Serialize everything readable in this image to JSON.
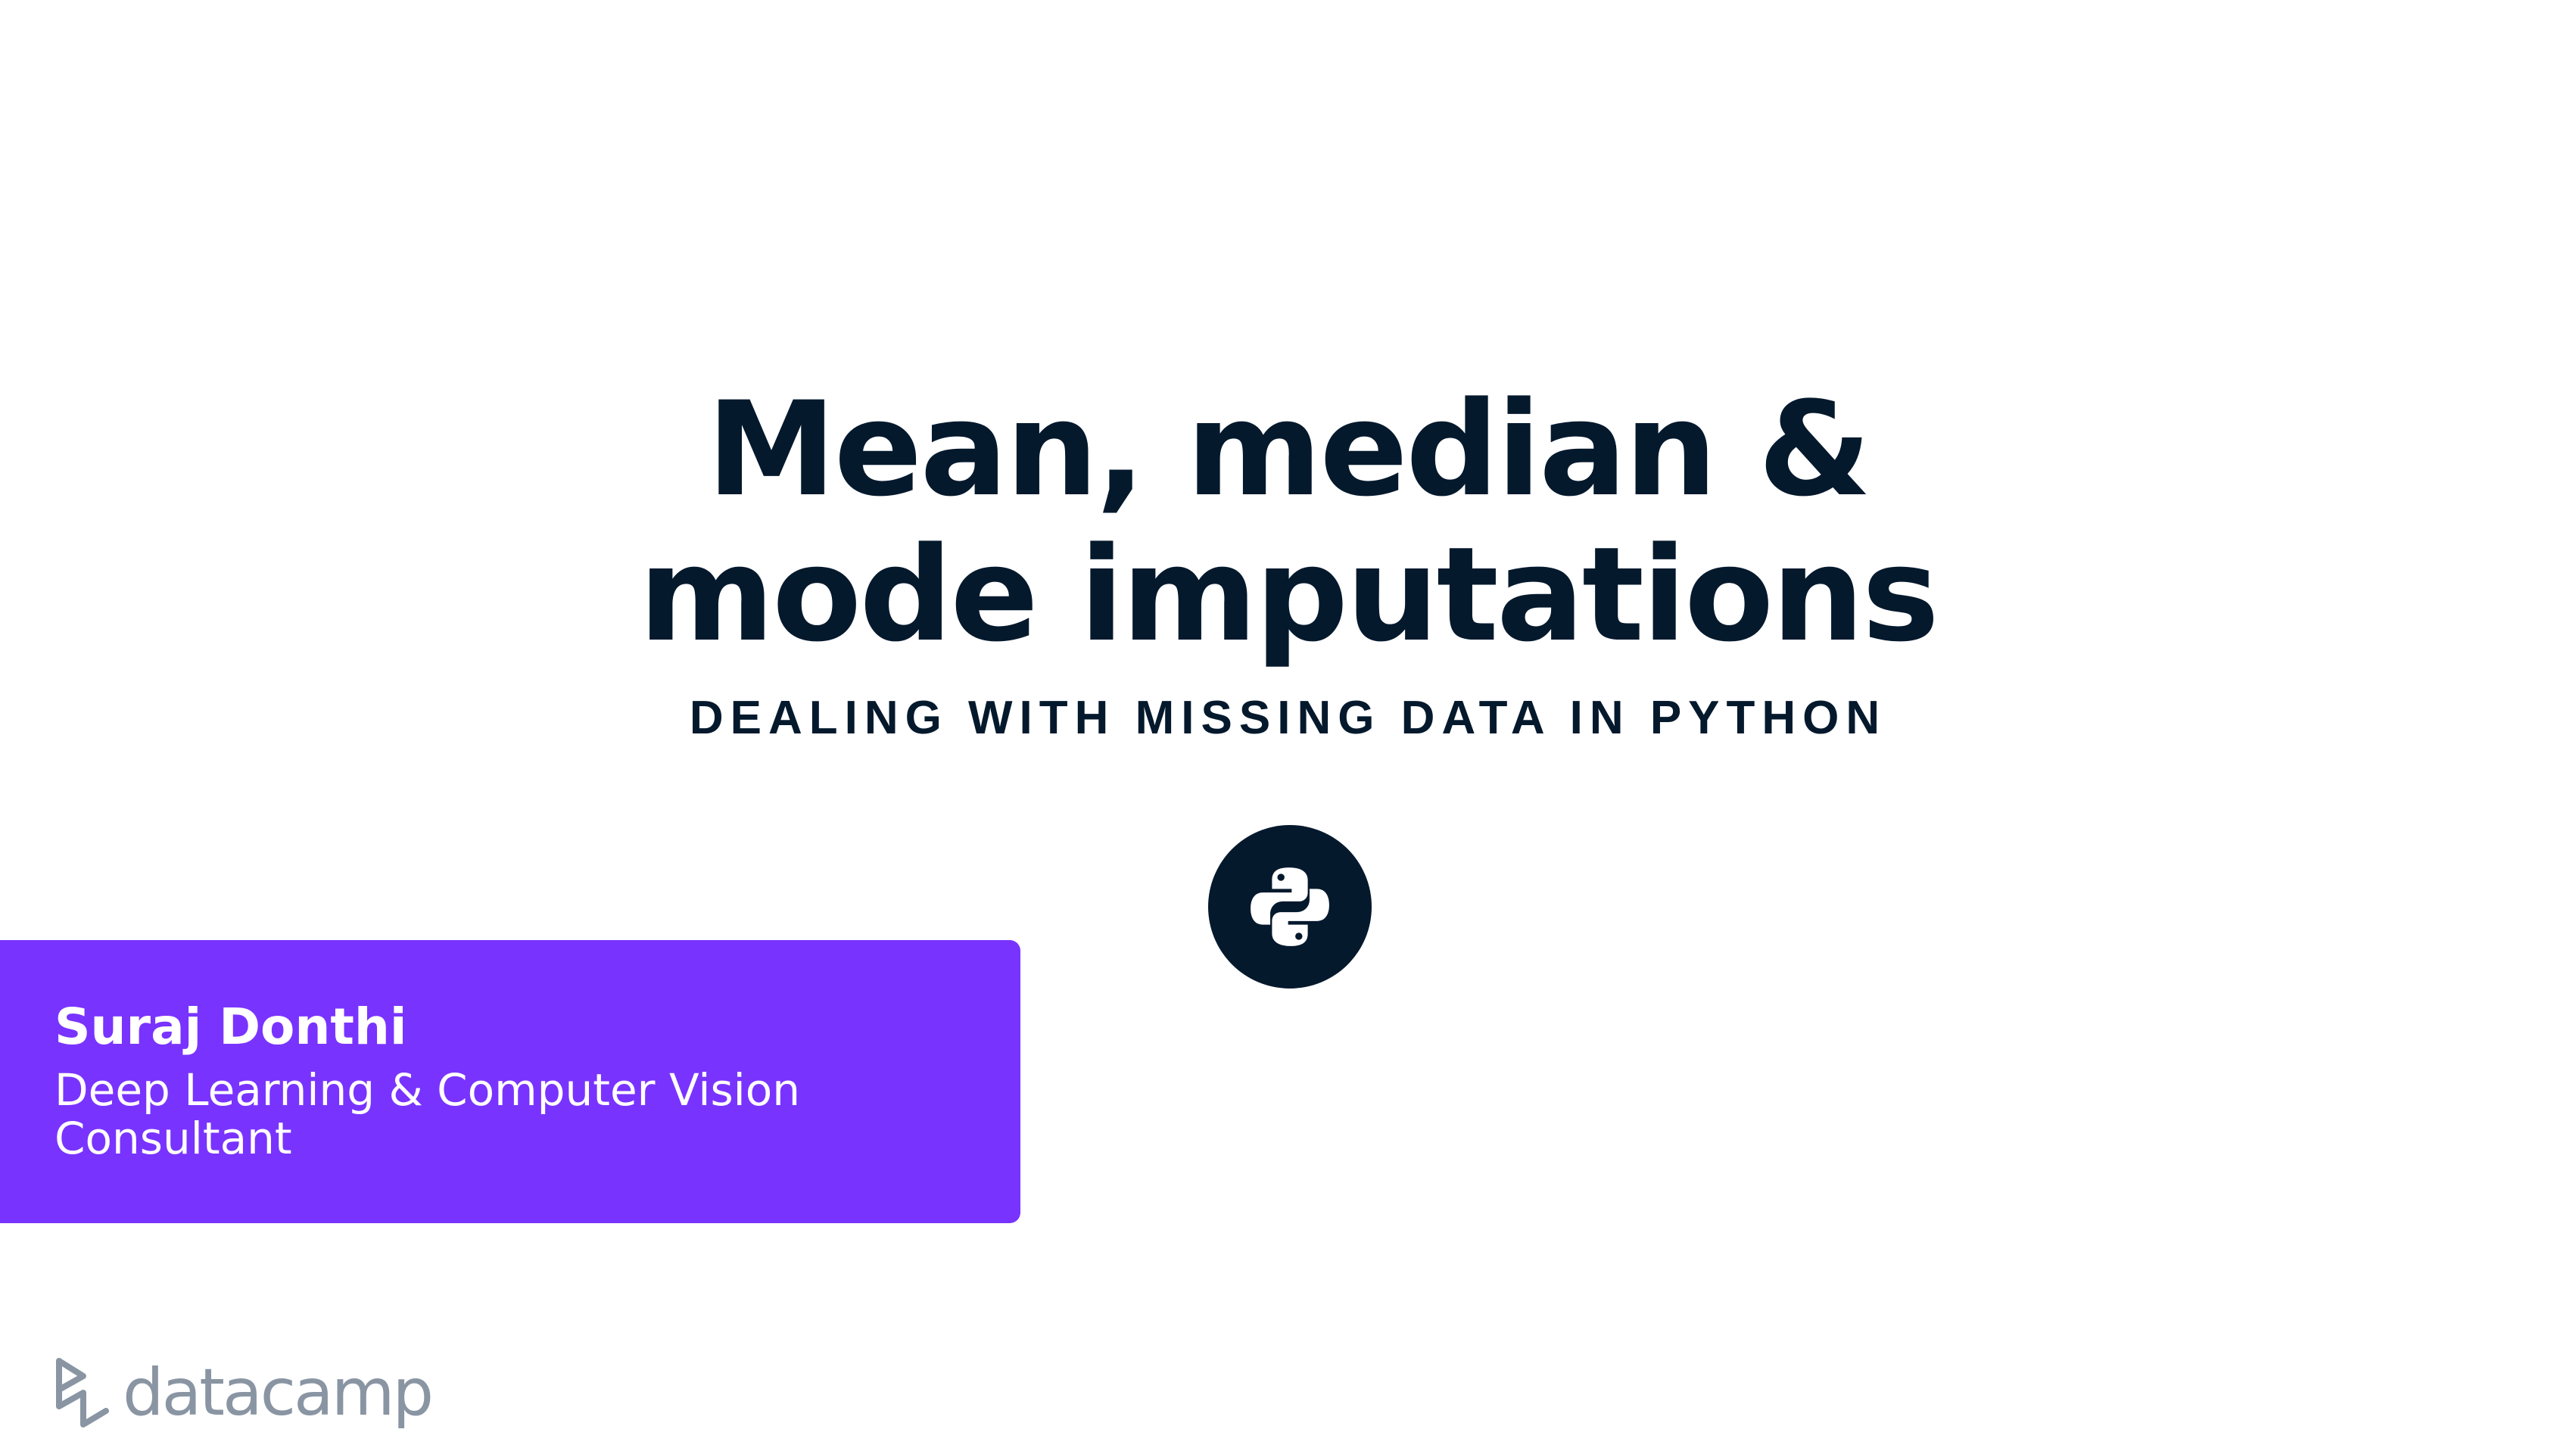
{
  "slide": {
    "title_lines": [
      "Mean, median &",
      "mode imputations"
    ],
    "course": "DEALING WITH MISSING DATA IN PYTHON",
    "badge_icon": "python-logo-icon"
  },
  "instructor": {
    "name": "Suraj Donthi",
    "role": "Deep Learning & Computer Vision Consultant"
  },
  "brand": {
    "logo_icon": "datacamp-logo-icon",
    "wordmark": "datacamp"
  },
  "colors": {
    "navy": "#05192d",
    "purple": "#7933ff",
    "brand_gray": "#8a95a3",
    "background": "#ffffff"
  }
}
